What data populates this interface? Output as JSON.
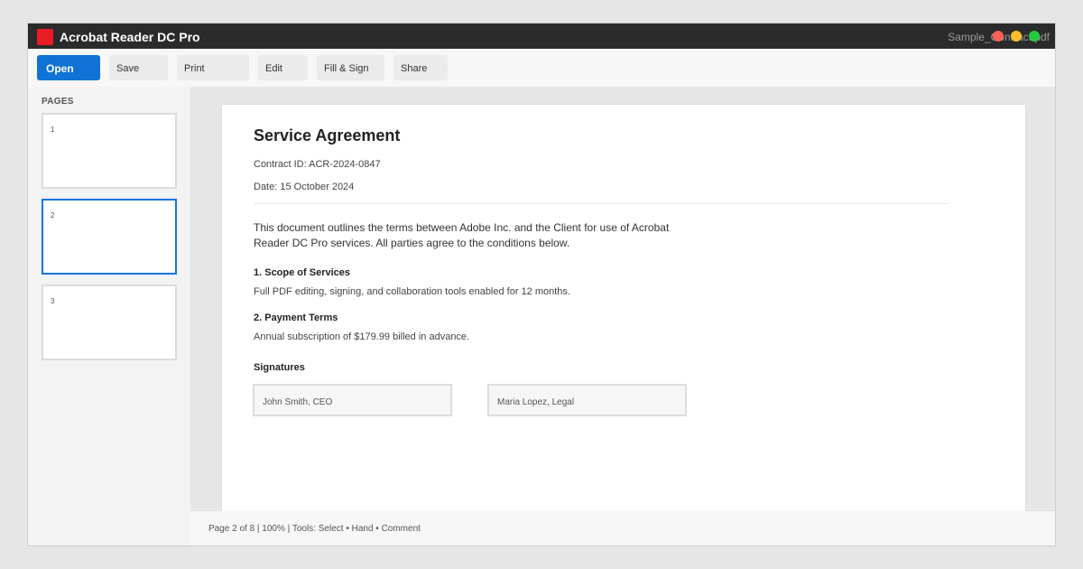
{
  "app": {
    "title": "Acrobat Reader DC Pro",
    "file_name": "Sample_Contract.pdf",
    "brand_color": "#ec1c24",
    "accent_color": "#1473e6"
  },
  "toolbar": {
    "open_label": "Open",
    "save_label": "Save",
    "print_label": "Print",
    "edit_label": "Edit",
    "fill_sign_label": "Fill & Sign",
    "share_label": "Share"
  },
  "sidebar": {
    "heading": "PAGES",
    "thumbnails": [
      {
        "number": "1",
        "selected": false
      },
      {
        "number": "2",
        "selected": true
      },
      {
        "number": "3",
        "selected": false
      }
    ]
  },
  "document": {
    "title": "Service Agreement",
    "contract_id": "Contract ID: ACR-2024-0847",
    "date": "Date: 15 October 2024",
    "intro": "This document outlines the terms between Adobe Inc. and the Client for use of Acrobat Reader DC Pro services. All parties agree to the conditions below.",
    "sections": [
      {
        "heading": "1. Scope of Services",
        "body": "Full PDF editing, signing, and collaboration tools enabled for 12 months."
      },
      {
        "heading": "2. Payment Terms",
        "body": "Annual subscription of $179.99 billed in advance."
      }
    ],
    "signatures_heading": "Signatures",
    "signatures": [
      "John Smith, CEO",
      "Maria Lopez, Legal"
    ]
  },
  "status": {
    "text": "Page 2 of 8 | 100% | Tools: Select • Hand • Comment"
  }
}
